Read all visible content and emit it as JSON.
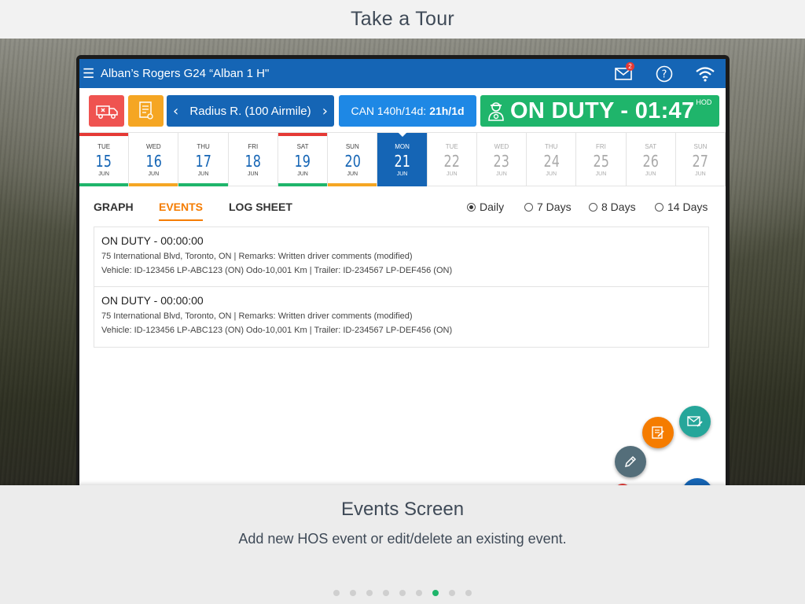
{
  "tour": {
    "title": "Take a Tour"
  },
  "appbar": {
    "title": "Alban’s Rogers G24 “Alban 1 H\"",
    "mail_badge": "2"
  },
  "status": {
    "radius_label": "Radius R. (100 Airmile)",
    "can_prefix": "CAN 140h/14d:",
    "can_value": "21h/1d",
    "duty": "ON DUTY - 01:47",
    "duty_suffix": "HOD"
  },
  "days": [
    {
      "dow": "TUE",
      "num": "15",
      "mon": "JUN",
      "top": "#e53935",
      "bottom": "#1fb56b",
      "state": "past"
    },
    {
      "dow": "WED",
      "num": "16",
      "mon": "JUN",
      "top": "",
      "bottom": "#f5a623",
      "state": "past"
    },
    {
      "dow": "THU",
      "num": "17",
      "mon": "JUN",
      "top": "",
      "bottom": "#1fb56b",
      "state": "past"
    },
    {
      "dow": "FRI",
      "num": "18",
      "mon": "JUN",
      "top": "",
      "bottom": "",
      "state": "past"
    },
    {
      "dow": "SAT",
      "num": "19",
      "mon": "JUN",
      "top": "#e53935",
      "bottom": "#1fb56b",
      "state": "past"
    },
    {
      "dow": "SUN",
      "num": "20",
      "mon": "JUN",
      "top": "",
      "bottom": "#f5a623",
      "state": "past"
    },
    {
      "dow": "MON",
      "num": "21",
      "mon": "JUN",
      "top": "",
      "bottom": "",
      "state": "selected"
    },
    {
      "dow": "TUE",
      "num": "22",
      "mon": "JUN",
      "top": "",
      "bottom": "",
      "state": "future"
    },
    {
      "dow": "WED",
      "num": "23",
      "mon": "JUN",
      "top": "",
      "bottom": "",
      "state": "future"
    },
    {
      "dow": "THU",
      "num": "24",
      "mon": "JUN",
      "top": "",
      "bottom": "",
      "state": "future"
    },
    {
      "dow": "FRI",
      "num": "25",
      "mon": "JUN",
      "top": "",
      "bottom": "",
      "state": "future"
    },
    {
      "dow": "SAT",
      "num": "26",
      "mon": "JUN",
      "top": "",
      "bottom": "",
      "state": "future"
    },
    {
      "dow": "SUN",
      "num": "27",
      "mon": "JUN",
      "top": "",
      "bottom": "",
      "state": "future"
    }
  ],
  "tabs": {
    "graph": "GRAPH",
    "events": "EVENTS",
    "log_sheet": "LOG SHEET",
    "active": "EVENTS"
  },
  "range_options": {
    "daily": "Daily",
    "seven": "7 Days",
    "eight": "8 Days",
    "fourteen": "14 Days",
    "selected": "Daily"
  },
  "events": [
    {
      "title": "ON DUTY - 00:00:00",
      "line1": "75 International Blvd, Toronto, ON | Remarks: Written driver comments (modified)",
      "line2": "Vehicle: ID-123456 LP-ABC123 (ON) Odo-10,001 Km | Trailer: ID-234567 LP-DEF456 (ON)"
    },
    {
      "title": "ON DUTY - 00:00:00",
      "line1": "75 International Blvd, Toronto, ON | Remarks: Written driver comments (modified)",
      "line2": "Vehicle: ID-123456 LP-ABC123 (ON) Odo-10,001 Km | Trailer: ID-234567 LP-DEF456 (ON)"
    }
  ],
  "icons": {
    "menu": "hamburger-icon",
    "mail": "mail-icon",
    "help": "help-icon",
    "wifi": "wifi-icon",
    "truck": "truck-alert-icon",
    "docs": "document-icon",
    "driver": "driver-icon",
    "fab_mail": "mail-edit-icon",
    "fab_note": "note-edit-icon",
    "fab_pencil": "pencil-icon"
  },
  "colors": {
    "primary": "#1565b5",
    "accent_orange": "#f57c00",
    "duty_green": "#1fb56b",
    "alert_red": "#ef5350",
    "doc_yellow": "#f5a623",
    "fab_teal": "#26a69a",
    "fab_gray": "#546e7a"
  },
  "panel": {
    "title": "Events Screen",
    "description": "Add new HOS event or edit/delete an existing event.",
    "dots_count": 9,
    "active_dot": 6
  }
}
